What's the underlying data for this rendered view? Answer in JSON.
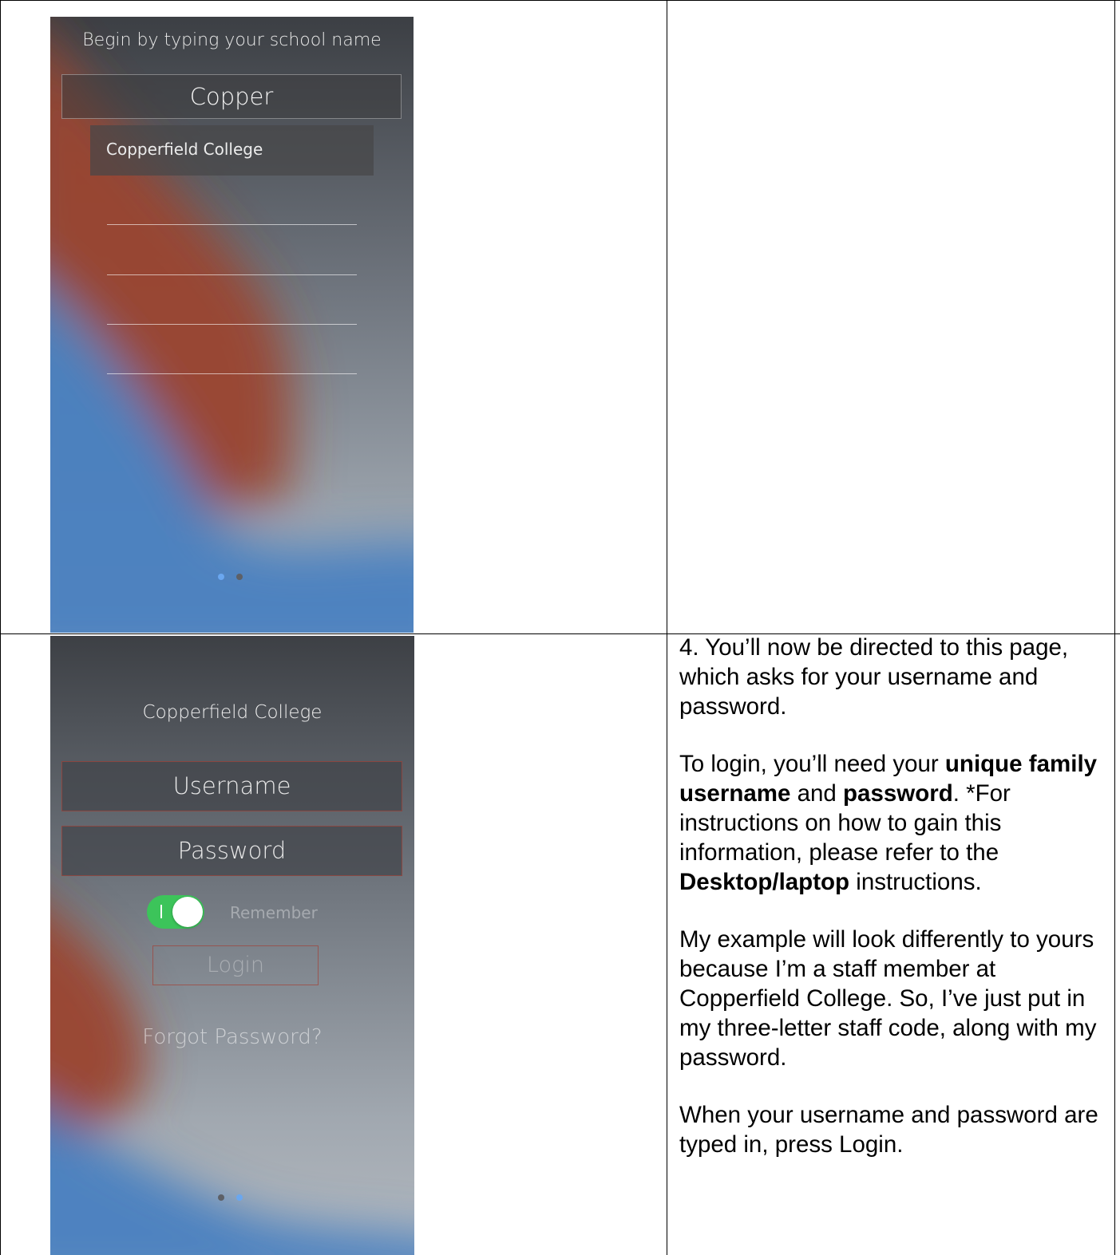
{
  "screen1": {
    "hint": "Begin by typing your school name",
    "search_value": "Copper",
    "suggestion": "Copperfield College"
  },
  "screen2": {
    "school_name": "Copperfield College",
    "username_placeholder": "Username",
    "password_placeholder": "Password",
    "remember_label": "Remember",
    "remember_on": true,
    "login_label": "Login",
    "forgot_label": "Forgot Password?"
  },
  "instructions": {
    "para1": "4. You’ll now be directed to this page, which asks for your username and password.",
    "para2": {
      "t1": "To login, you’ll need your ",
      "b1": "unique family username",
      "t2": " and ",
      "b2": "password",
      "t3": ". *For instructions on how to gain this information, please refer to the ",
      "b3": "Desktop/laptop",
      "t4": " instructions."
    },
    "para3": "My example will look differently to yours because I’m a staff member at Copperfield College. So, I’ve just put in my three-letter staff code, along with my password.",
    "para4": "When your username and password are typed in, press Login."
  },
  "colors": {
    "toggle_on": "#3cc45a",
    "dot_active": "#6aa7f0",
    "dot_inactive": "#5d6067"
  }
}
